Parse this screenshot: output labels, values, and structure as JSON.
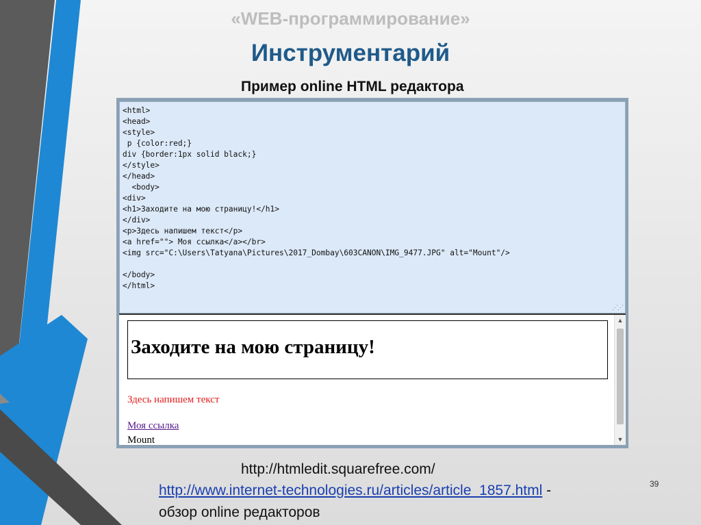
{
  "slide": {
    "subtitle": "«WEB-программирование»",
    "title": "Инструментарий",
    "caption": "Пример  online HTML редактора",
    "page_number": "39"
  },
  "editor": {
    "code_lines": [
      "<html>",
      "<head>",
      "<style>",
      " p {color:red;}",
      "div {border:1px solid black;}",
      "</style>",
      "</head>",
      "  <body>",
      "<div>",
      "<h1>Заходите на мою страницу!</h1>",
      "</div>",
      "<p>Здесь напишем текст</p>",
      "<a href=\"\"> Моя ссылка</a></br>",
      "<img src=\"C:\\Users\\Tatyana\\Pictures\\2017_Dombay\\603CANON\\IMG_9477.JPG\" alt=\"Mount\"/>",
      "",
      "</body>",
      "</html>"
    ]
  },
  "preview": {
    "heading": "Заходите на мою страницу!",
    "paragraph": "Здесь напишем текст",
    "link": "Моя ссылка",
    "img_alt": "Mount"
  },
  "links": {
    "url1": "http://htmledit.squarefree.com/",
    "url2": "http://www.internet-technologies.ru/articles/article_1857.html",
    "url2_suffix": " -",
    "note": "обзор online редакторов"
  },
  "colors": {
    "title": "#1f5a8a",
    "accent_blue": "#1e88d4",
    "accent_gray": "#5a5a5a",
    "code_bg": "#dce9f8",
    "preview_text_red": "#e0201f"
  },
  "icons": [
    "scroll-up-arrow-icon",
    "scroll-down-arrow-icon",
    "resize-grip-icon"
  ]
}
